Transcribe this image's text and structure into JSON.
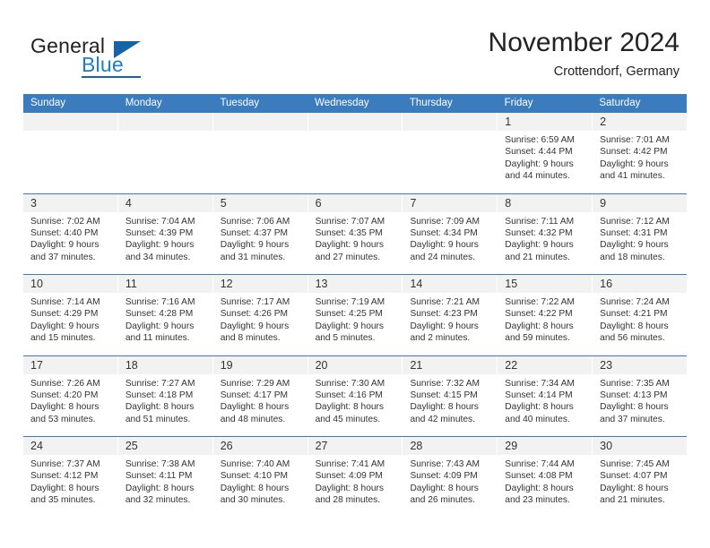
{
  "brand": {
    "name_top": "General",
    "name_bottom": "Blue",
    "triangle_icon": "triangle-icon",
    "color_dark": "#231f20",
    "color_blue": "#1763a8"
  },
  "header": {
    "title": "November 2024",
    "subtitle": "Crottendorf, Germany"
  },
  "theme": {
    "header_blue": "#3a7cbe",
    "band_gray": "#f2f2f2",
    "text": "#333333"
  },
  "weekdays": [
    "Sunday",
    "Monday",
    "Tuesday",
    "Wednesday",
    "Thursday",
    "Friday",
    "Saturday"
  ],
  "weeks": [
    [
      {
        "empty": true
      },
      {
        "empty": true
      },
      {
        "empty": true
      },
      {
        "empty": true
      },
      {
        "empty": true
      },
      {
        "day": "1",
        "sunrise": "Sunrise: 6:59 AM",
        "sunset": "Sunset: 4:44 PM",
        "daylight1": "Daylight: 9 hours",
        "daylight2": "and 44 minutes."
      },
      {
        "day": "2",
        "sunrise": "Sunrise: 7:01 AM",
        "sunset": "Sunset: 4:42 PM",
        "daylight1": "Daylight: 9 hours",
        "daylight2": "and 41 minutes."
      }
    ],
    [
      {
        "day": "3",
        "sunrise": "Sunrise: 7:02 AM",
        "sunset": "Sunset: 4:40 PM",
        "daylight1": "Daylight: 9 hours",
        "daylight2": "and 37 minutes."
      },
      {
        "day": "4",
        "sunrise": "Sunrise: 7:04 AM",
        "sunset": "Sunset: 4:39 PM",
        "daylight1": "Daylight: 9 hours",
        "daylight2": "and 34 minutes."
      },
      {
        "day": "5",
        "sunrise": "Sunrise: 7:06 AM",
        "sunset": "Sunset: 4:37 PM",
        "daylight1": "Daylight: 9 hours",
        "daylight2": "and 31 minutes."
      },
      {
        "day": "6",
        "sunrise": "Sunrise: 7:07 AM",
        "sunset": "Sunset: 4:35 PM",
        "daylight1": "Daylight: 9 hours",
        "daylight2": "and 27 minutes."
      },
      {
        "day": "7",
        "sunrise": "Sunrise: 7:09 AM",
        "sunset": "Sunset: 4:34 PM",
        "daylight1": "Daylight: 9 hours",
        "daylight2": "and 24 minutes."
      },
      {
        "day": "8",
        "sunrise": "Sunrise: 7:11 AM",
        "sunset": "Sunset: 4:32 PM",
        "daylight1": "Daylight: 9 hours",
        "daylight2": "and 21 minutes."
      },
      {
        "day": "9",
        "sunrise": "Sunrise: 7:12 AM",
        "sunset": "Sunset: 4:31 PM",
        "daylight1": "Daylight: 9 hours",
        "daylight2": "and 18 minutes."
      }
    ],
    [
      {
        "day": "10",
        "sunrise": "Sunrise: 7:14 AM",
        "sunset": "Sunset: 4:29 PM",
        "daylight1": "Daylight: 9 hours",
        "daylight2": "and 15 minutes."
      },
      {
        "day": "11",
        "sunrise": "Sunrise: 7:16 AM",
        "sunset": "Sunset: 4:28 PM",
        "daylight1": "Daylight: 9 hours",
        "daylight2": "and 11 minutes."
      },
      {
        "day": "12",
        "sunrise": "Sunrise: 7:17 AM",
        "sunset": "Sunset: 4:26 PM",
        "daylight1": "Daylight: 9 hours",
        "daylight2": "and 8 minutes."
      },
      {
        "day": "13",
        "sunrise": "Sunrise: 7:19 AM",
        "sunset": "Sunset: 4:25 PM",
        "daylight1": "Daylight: 9 hours",
        "daylight2": "and 5 minutes."
      },
      {
        "day": "14",
        "sunrise": "Sunrise: 7:21 AM",
        "sunset": "Sunset: 4:23 PM",
        "daylight1": "Daylight: 9 hours",
        "daylight2": "and 2 minutes."
      },
      {
        "day": "15",
        "sunrise": "Sunrise: 7:22 AM",
        "sunset": "Sunset: 4:22 PM",
        "daylight1": "Daylight: 8 hours",
        "daylight2": "and 59 minutes."
      },
      {
        "day": "16",
        "sunrise": "Sunrise: 7:24 AM",
        "sunset": "Sunset: 4:21 PM",
        "daylight1": "Daylight: 8 hours",
        "daylight2": "and 56 minutes."
      }
    ],
    [
      {
        "day": "17",
        "sunrise": "Sunrise: 7:26 AM",
        "sunset": "Sunset: 4:20 PM",
        "daylight1": "Daylight: 8 hours",
        "daylight2": "and 53 minutes."
      },
      {
        "day": "18",
        "sunrise": "Sunrise: 7:27 AM",
        "sunset": "Sunset: 4:18 PM",
        "daylight1": "Daylight: 8 hours",
        "daylight2": "and 51 minutes."
      },
      {
        "day": "19",
        "sunrise": "Sunrise: 7:29 AM",
        "sunset": "Sunset: 4:17 PM",
        "daylight1": "Daylight: 8 hours",
        "daylight2": "and 48 minutes."
      },
      {
        "day": "20",
        "sunrise": "Sunrise: 7:30 AM",
        "sunset": "Sunset: 4:16 PM",
        "daylight1": "Daylight: 8 hours",
        "daylight2": "and 45 minutes."
      },
      {
        "day": "21",
        "sunrise": "Sunrise: 7:32 AM",
        "sunset": "Sunset: 4:15 PM",
        "daylight1": "Daylight: 8 hours",
        "daylight2": "and 42 minutes."
      },
      {
        "day": "22",
        "sunrise": "Sunrise: 7:34 AM",
        "sunset": "Sunset: 4:14 PM",
        "daylight1": "Daylight: 8 hours",
        "daylight2": "and 40 minutes."
      },
      {
        "day": "23",
        "sunrise": "Sunrise: 7:35 AM",
        "sunset": "Sunset: 4:13 PM",
        "daylight1": "Daylight: 8 hours",
        "daylight2": "and 37 minutes."
      }
    ],
    [
      {
        "day": "24",
        "sunrise": "Sunrise: 7:37 AM",
        "sunset": "Sunset: 4:12 PM",
        "daylight1": "Daylight: 8 hours",
        "daylight2": "and 35 minutes."
      },
      {
        "day": "25",
        "sunrise": "Sunrise: 7:38 AM",
        "sunset": "Sunset: 4:11 PM",
        "daylight1": "Daylight: 8 hours",
        "daylight2": "and 32 minutes."
      },
      {
        "day": "26",
        "sunrise": "Sunrise: 7:40 AM",
        "sunset": "Sunset: 4:10 PM",
        "daylight1": "Daylight: 8 hours",
        "daylight2": "and 30 minutes."
      },
      {
        "day": "27",
        "sunrise": "Sunrise: 7:41 AM",
        "sunset": "Sunset: 4:09 PM",
        "daylight1": "Daylight: 8 hours",
        "daylight2": "and 28 minutes."
      },
      {
        "day": "28",
        "sunrise": "Sunrise: 7:43 AM",
        "sunset": "Sunset: 4:09 PM",
        "daylight1": "Daylight: 8 hours",
        "daylight2": "and 26 minutes."
      },
      {
        "day": "29",
        "sunrise": "Sunrise: 7:44 AM",
        "sunset": "Sunset: 4:08 PM",
        "daylight1": "Daylight: 8 hours",
        "daylight2": "and 23 minutes."
      },
      {
        "day": "30",
        "sunrise": "Sunrise: 7:45 AM",
        "sunset": "Sunset: 4:07 PM",
        "daylight1": "Daylight: 8 hours",
        "daylight2": "and 21 minutes."
      }
    ]
  ]
}
